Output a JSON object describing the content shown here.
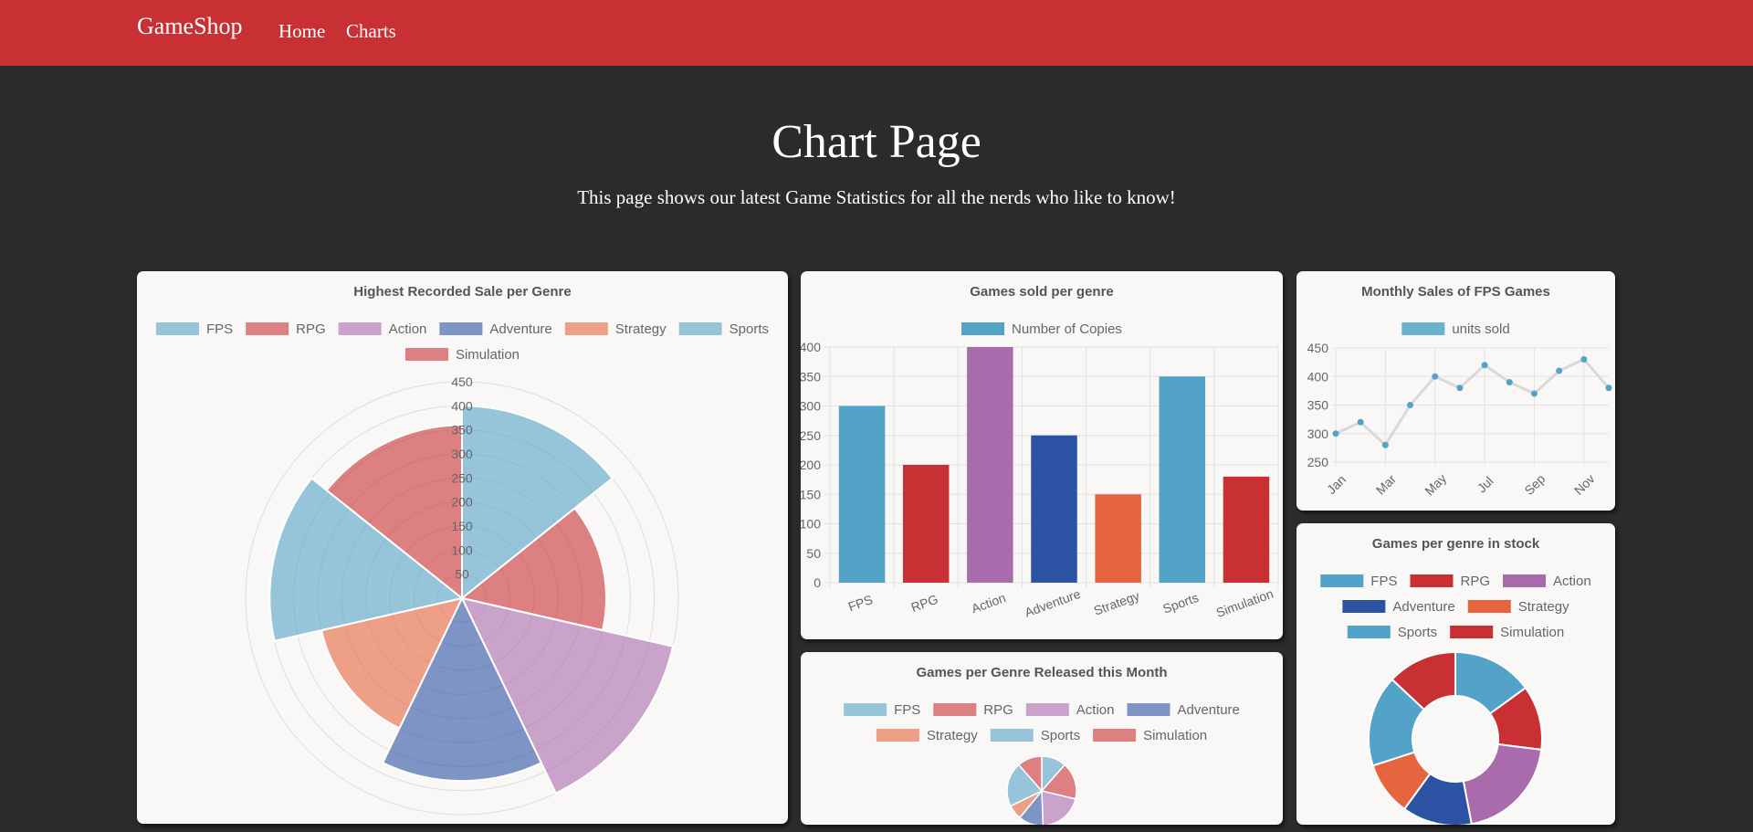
{
  "nav": {
    "brand": "GameShop",
    "links": [
      "Home",
      "Charts"
    ]
  },
  "hero": {
    "title": "Chart Page",
    "subtitle": "This page shows our latest Game Statistics for all the nerds who like to know!"
  },
  "colors": {
    "navbar": "#c83034",
    "background": "#2b2b2b",
    "card": "#f9f8f6",
    "series": [
      "#53a3c8",
      "#c83034",
      "#a96bab",
      "#2b52a3",
      "#e6643e",
      "#53a3c8",
      "#c83034"
    ]
  },
  "chart_data": [
    {
      "type": "polarArea",
      "title": "Highest Recorded Sale per Genre",
      "categories": [
        "FPS",
        "RPG",
        "Action",
        "Adventure",
        "Strategy",
        "Sports",
        "Simulation"
      ],
      "values": [
        400,
        300,
        450,
        380,
        300,
        400,
        360
      ],
      "rlim": [
        0,
        450
      ],
      "ticks": [
        50,
        100,
        150,
        200,
        250,
        300,
        350,
        400,
        450
      ],
      "legend": "top"
    },
    {
      "type": "bar",
      "title": "Games sold per genre",
      "series": [
        {
          "name": "Number of Copies",
          "values": [
            300,
            200,
            400,
            250,
            150,
            350,
            180
          ]
        }
      ],
      "categories": [
        "FPS",
        "RPG",
        "Action",
        "Adventure",
        "Strategy",
        "Sports",
        "Simulation"
      ],
      "ylim": [
        0,
        400
      ],
      "yticks": [
        0,
        50,
        100,
        150,
        200,
        250,
        300,
        350,
        400
      ],
      "grid": true,
      "legend": "top"
    },
    {
      "type": "line",
      "title": "Monthly Sales of FPS Games",
      "series": [
        {
          "name": "units sold",
          "values": [
            300,
            320,
            280,
            350,
            400,
            380,
            420,
            390,
            370,
            410,
            430,
            380
          ]
        }
      ],
      "x": [
        "Jan",
        "Feb",
        "Mar",
        "Apr",
        "May",
        "Jun",
        "Jul",
        "Aug",
        "Sep",
        "Oct",
        "Nov",
        "Dec"
      ],
      "xtick_labels": [
        "Jan",
        "Mar",
        "May",
        "Jul",
        "Sep",
        "Nov"
      ],
      "ylim": [
        250,
        450
      ],
      "yticks": [
        250,
        300,
        350,
        400,
        450
      ],
      "grid": true,
      "legend": "top"
    },
    {
      "type": "pie",
      "title": "Games per Genre Released this Month",
      "categories": [
        "FPS",
        "RPG",
        "Action",
        "Adventure",
        "Strategy",
        "Sports",
        "Simulation"
      ],
      "values": [
        10,
        15,
        18,
        10,
        6,
        18,
        10
      ],
      "legend": "top"
    },
    {
      "type": "doughnut",
      "title": "Games per genre in stock",
      "categories": [
        "FPS",
        "RPG",
        "Action",
        "Adventure",
        "Strategy",
        "Sports",
        "Simulation"
      ],
      "values": [
        15,
        12,
        20,
        13,
        10,
        17,
        13
      ],
      "legend": "top"
    }
  ]
}
